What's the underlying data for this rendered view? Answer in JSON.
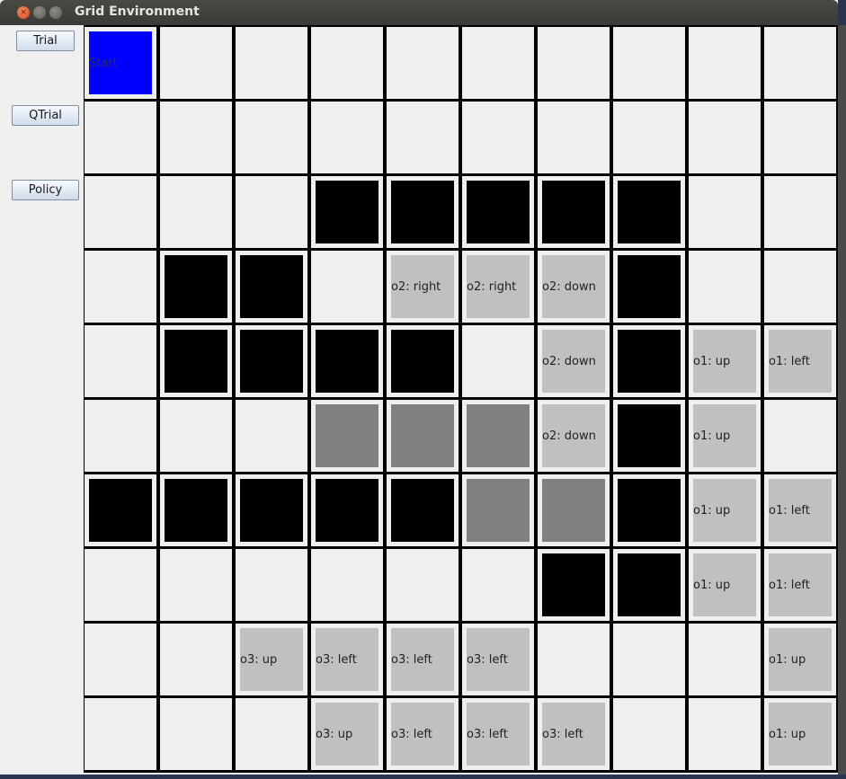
{
  "window": {
    "title": "Grid Environment"
  },
  "sidebar": {
    "buttons": [
      {
        "label": "Trial"
      },
      {
        "label": "QTrial"
      },
      {
        "label": "Policy"
      }
    ]
  },
  "colors": {
    "start": "#0000ff",
    "wall": "#000000",
    "policy": "#c0c0c0",
    "dark_gray": "#808080",
    "empty": "#efefef",
    "grid_lines": "#000000"
  },
  "grid": {
    "rows": 10,
    "cols": 10,
    "cells": [
      [
        {
          "t": "start",
          "label": "Start"
        },
        {
          "t": "empty"
        },
        {
          "t": "empty"
        },
        {
          "t": "empty"
        },
        {
          "t": "empty"
        },
        {
          "t": "empty"
        },
        {
          "t": "empty"
        },
        {
          "t": "empty"
        },
        {
          "t": "empty"
        },
        {
          "t": "empty"
        }
      ],
      [
        {
          "t": "empty"
        },
        {
          "t": "empty"
        },
        {
          "t": "empty"
        },
        {
          "t": "empty"
        },
        {
          "t": "empty"
        },
        {
          "t": "empty"
        },
        {
          "t": "empty"
        },
        {
          "t": "empty"
        },
        {
          "t": "empty"
        },
        {
          "t": "empty"
        }
      ],
      [
        {
          "t": "empty"
        },
        {
          "t": "empty"
        },
        {
          "t": "empty"
        },
        {
          "t": "wall"
        },
        {
          "t": "wall"
        },
        {
          "t": "wall"
        },
        {
          "t": "wall"
        },
        {
          "t": "wall"
        },
        {
          "t": "empty"
        },
        {
          "t": "empty"
        }
      ],
      [
        {
          "t": "empty"
        },
        {
          "t": "wall"
        },
        {
          "t": "wall"
        },
        {
          "t": "empty"
        },
        {
          "t": "policy",
          "label": "o2: right"
        },
        {
          "t": "policy",
          "label": "o2: right"
        },
        {
          "t": "policy",
          "label": "o2: down"
        },
        {
          "t": "wall"
        },
        {
          "t": "empty"
        },
        {
          "t": "empty"
        }
      ],
      [
        {
          "t": "empty"
        },
        {
          "t": "wall"
        },
        {
          "t": "wall"
        },
        {
          "t": "wall"
        },
        {
          "t": "wall"
        },
        {
          "t": "empty"
        },
        {
          "t": "policy",
          "label": "o2: down"
        },
        {
          "t": "wall"
        },
        {
          "t": "policy",
          "label": "o1: up"
        },
        {
          "t": "policy",
          "label": "o1: left"
        }
      ],
      [
        {
          "t": "empty"
        },
        {
          "t": "empty"
        },
        {
          "t": "empty"
        },
        {
          "t": "dark"
        },
        {
          "t": "dark"
        },
        {
          "t": "dark"
        },
        {
          "t": "policy",
          "label": "o2: down"
        },
        {
          "t": "wall"
        },
        {
          "t": "policy",
          "label": "o1: up"
        },
        {
          "t": "empty"
        }
      ],
      [
        {
          "t": "wall"
        },
        {
          "t": "wall"
        },
        {
          "t": "wall"
        },
        {
          "t": "wall"
        },
        {
          "t": "wall"
        },
        {
          "t": "dark"
        },
        {
          "t": "dark"
        },
        {
          "t": "wall"
        },
        {
          "t": "policy",
          "label": "o1: up"
        },
        {
          "t": "policy",
          "label": "o1: left"
        }
      ],
      [
        {
          "t": "empty"
        },
        {
          "t": "empty"
        },
        {
          "t": "empty"
        },
        {
          "t": "empty"
        },
        {
          "t": "empty"
        },
        {
          "t": "empty"
        },
        {
          "t": "wall"
        },
        {
          "t": "wall"
        },
        {
          "t": "policy",
          "label": "o1: up"
        },
        {
          "t": "policy",
          "label": "o1: left"
        }
      ],
      [
        {
          "t": "empty"
        },
        {
          "t": "empty"
        },
        {
          "t": "policy",
          "label": "o3: up"
        },
        {
          "t": "policy",
          "label": "o3: left"
        },
        {
          "t": "policy",
          "label": "o3: left"
        },
        {
          "t": "policy",
          "label": "o3: left"
        },
        {
          "t": "empty"
        },
        {
          "t": "empty"
        },
        {
          "t": "empty"
        },
        {
          "t": "policy",
          "label": "o1: up"
        }
      ],
      [
        {
          "t": "empty"
        },
        {
          "t": "empty"
        },
        {
          "t": "empty"
        },
        {
          "t": "policy",
          "label": "o3: up"
        },
        {
          "t": "policy",
          "label": "o3: left"
        },
        {
          "t": "policy",
          "label": "o3: left"
        },
        {
          "t": "policy",
          "label": "o3: left"
        },
        {
          "t": "empty"
        },
        {
          "t": "empty"
        },
        {
          "t": "policy",
          "label": "o1: up"
        }
      ]
    ]
  }
}
